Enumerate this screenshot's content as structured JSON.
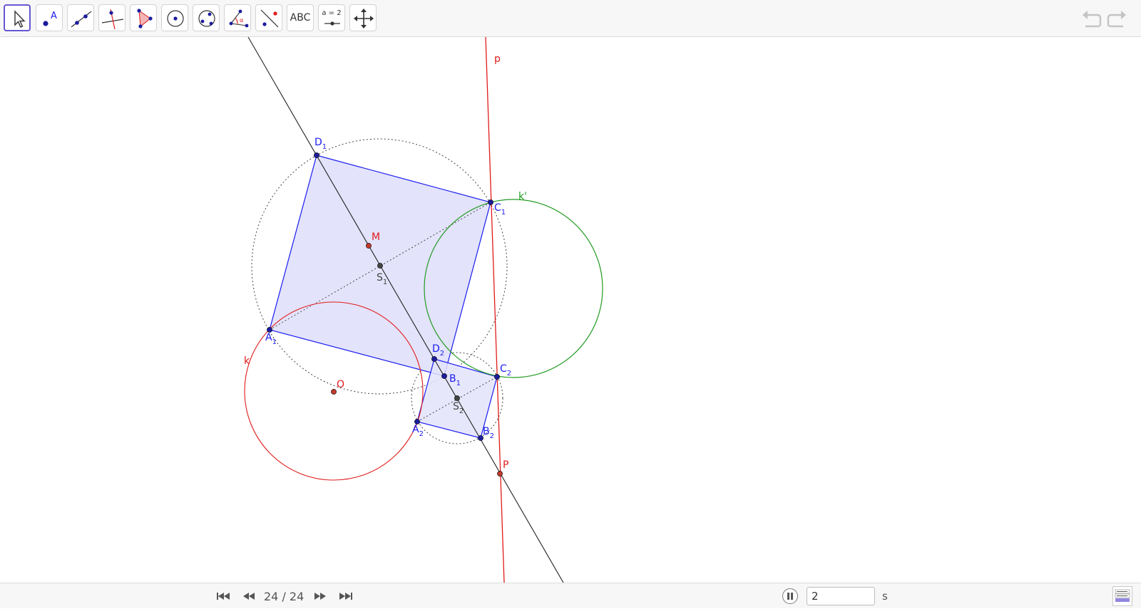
{
  "toolbar": {
    "tools": [
      {
        "name": "move-tool-icon",
        "selected": true
      },
      {
        "name": "point-tool-icon",
        "label": "A"
      },
      {
        "name": "line-tool-icon"
      },
      {
        "name": "perpendicular-line-tool-icon"
      },
      {
        "name": "polygon-tool-icon"
      },
      {
        "name": "circle-center-point-tool-icon"
      },
      {
        "name": "circle-three-points-tool-icon"
      },
      {
        "name": "angle-tool-icon",
        "label": "α"
      },
      {
        "name": "reflect-about-line-tool-icon"
      },
      {
        "name": "text-tool-icon",
        "label": "ABC"
      },
      {
        "name": "slider-tool-icon",
        "label": "a = 2"
      },
      {
        "name": "move-graphics-view-tool-icon"
      }
    ],
    "undo_icon": "undo-icon",
    "redo_icon": "redo-icon"
  },
  "construction": {
    "labels": {
      "p": "p",
      "k_prime": "k'",
      "k": "k",
      "D": "D",
      "C": "C",
      "A": "A",
      "B": "B",
      "S": "S",
      "sub1": "1",
      "sub2": "2",
      "M": "M",
      "O": "O",
      "P": "P"
    },
    "colors": {
      "polygon_fill": "#e3e3fb",
      "polygon_stroke": "#1c1cf0",
      "point_blue": "#1c1c9c",
      "red": "#e11b1b",
      "green": "#239b23",
      "black": "#222222",
      "gray": "#444444"
    }
  },
  "bottom": {
    "step_counter": "24 / 24",
    "speed_value": "2",
    "speed_unit": "s",
    "first_icon": "skip-to-start-icon",
    "prev_icon": "step-back-icon",
    "next_icon": "step-forward-icon",
    "last_icon": "skip-to-end-icon",
    "pause_icon": "pause-icon",
    "algebra_icon": "algebra-view-icon"
  }
}
